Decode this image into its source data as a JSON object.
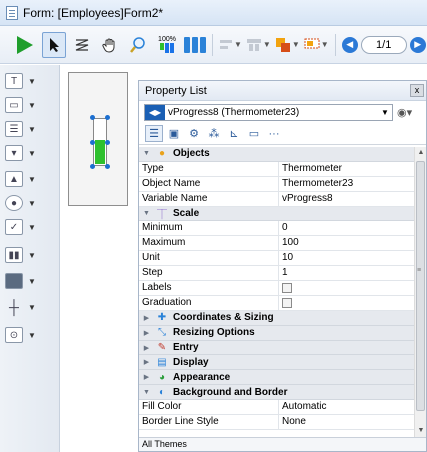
{
  "window": {
    "title": "Form: [Employees]Form2*"
  },
  "toolbar": {
    "gauge_percent": "100%",
    "page_indicator": "1/1",
    "tools": [
      "run-icon",
      "arrow-icon",
      "tab-order-icon",
      "hand-icon",
      "zoom-icon",
      "gauge-icon",
      "bars-icon",
      "align-icon",
      "distribute-icon",
      "arrange-icon",
      "color-icon"
    ]
  },
  "palette": {
    "tools": [
      "text-icon",
      "input-icon",
      "list-icon",
      "combo-icon",
      "button-icon",
      "radio-icon",
      "checkbox-icon",
      "progress-icon",
      "rectangle-icon",
      "line-icon",
      "plugin-icon"
    ]
  },
  "property_list": {
    "title": "Property List",
    "close": "x",
    "object_selector": "vProgress8 (Thermometer23)",
    "sections": [
      {
        "title": "Objects",
        "icon": "objects-icon",
        "expanded": true,
        "rows": [
          {
            "key": "Type",
            "value": "Thermometer"
          },
          {
            "key": "Object Name",
            "value": "Thermometer23"
          },
          {
            "key": "Variable Name",
            "value": "vProgress8"
          }
        ]
      },
      {
        "title": "Scale",
        "icon": "scale-icon",
        "expanded": true,
        "rows": [
          {
            "key": "Minimum",
            "value": "0"
          },
          {
            "key": "Maximum",
            "value": "100"
          },
          {
            "key": "Unit",
            "value": "10"
          },
          {
            "key": "Step",
            "value": "1"
          },
          {
            "key": "Labels",
            "value": "",
            "checkbox": true
          },
          {
            "key": "Graduation",
            "value": "",
            "checkbox": true
          }
        ]
      },
      {
        "title": "Coordinates & Sizing",
        "icon": "coordinates-icon",
        "expanded": false,
        "rows": []
      },
      {
        "title": "Resizing Options",
        "icon": "resize-icon",
        "expanded": false,
        "rows": []
      },
      {
        "title": "Entry",
        "icon": "entry-icon",
        "expanded": false,
        "rows": []
      },
      {
        "title": "Display",
        "icon": "display-icon",
        "expanded": false,
        "rows": []
      },
      {
        "title": "Appearance",
        "icon": "appearance-icon",
        "expanded": false,
        "rows": []
      },
      {
        "title": "Background and Border",
        "icon": "background-icon",
        "expanded": true,
        "rows": [
          {
            "key": "Fill Color",
            "value": "Automatic"
          },
          {
            "key": "Border Line Style",
            "value": "None"
          }
        ]
      }
    ],
    "footer": "All Themes"
  },
  "colors": {
    "accent": "#1a73e8",
    "thermometer_fill": "#2ec02e",
    "run_green": "#1f9e2c"
  }
}
